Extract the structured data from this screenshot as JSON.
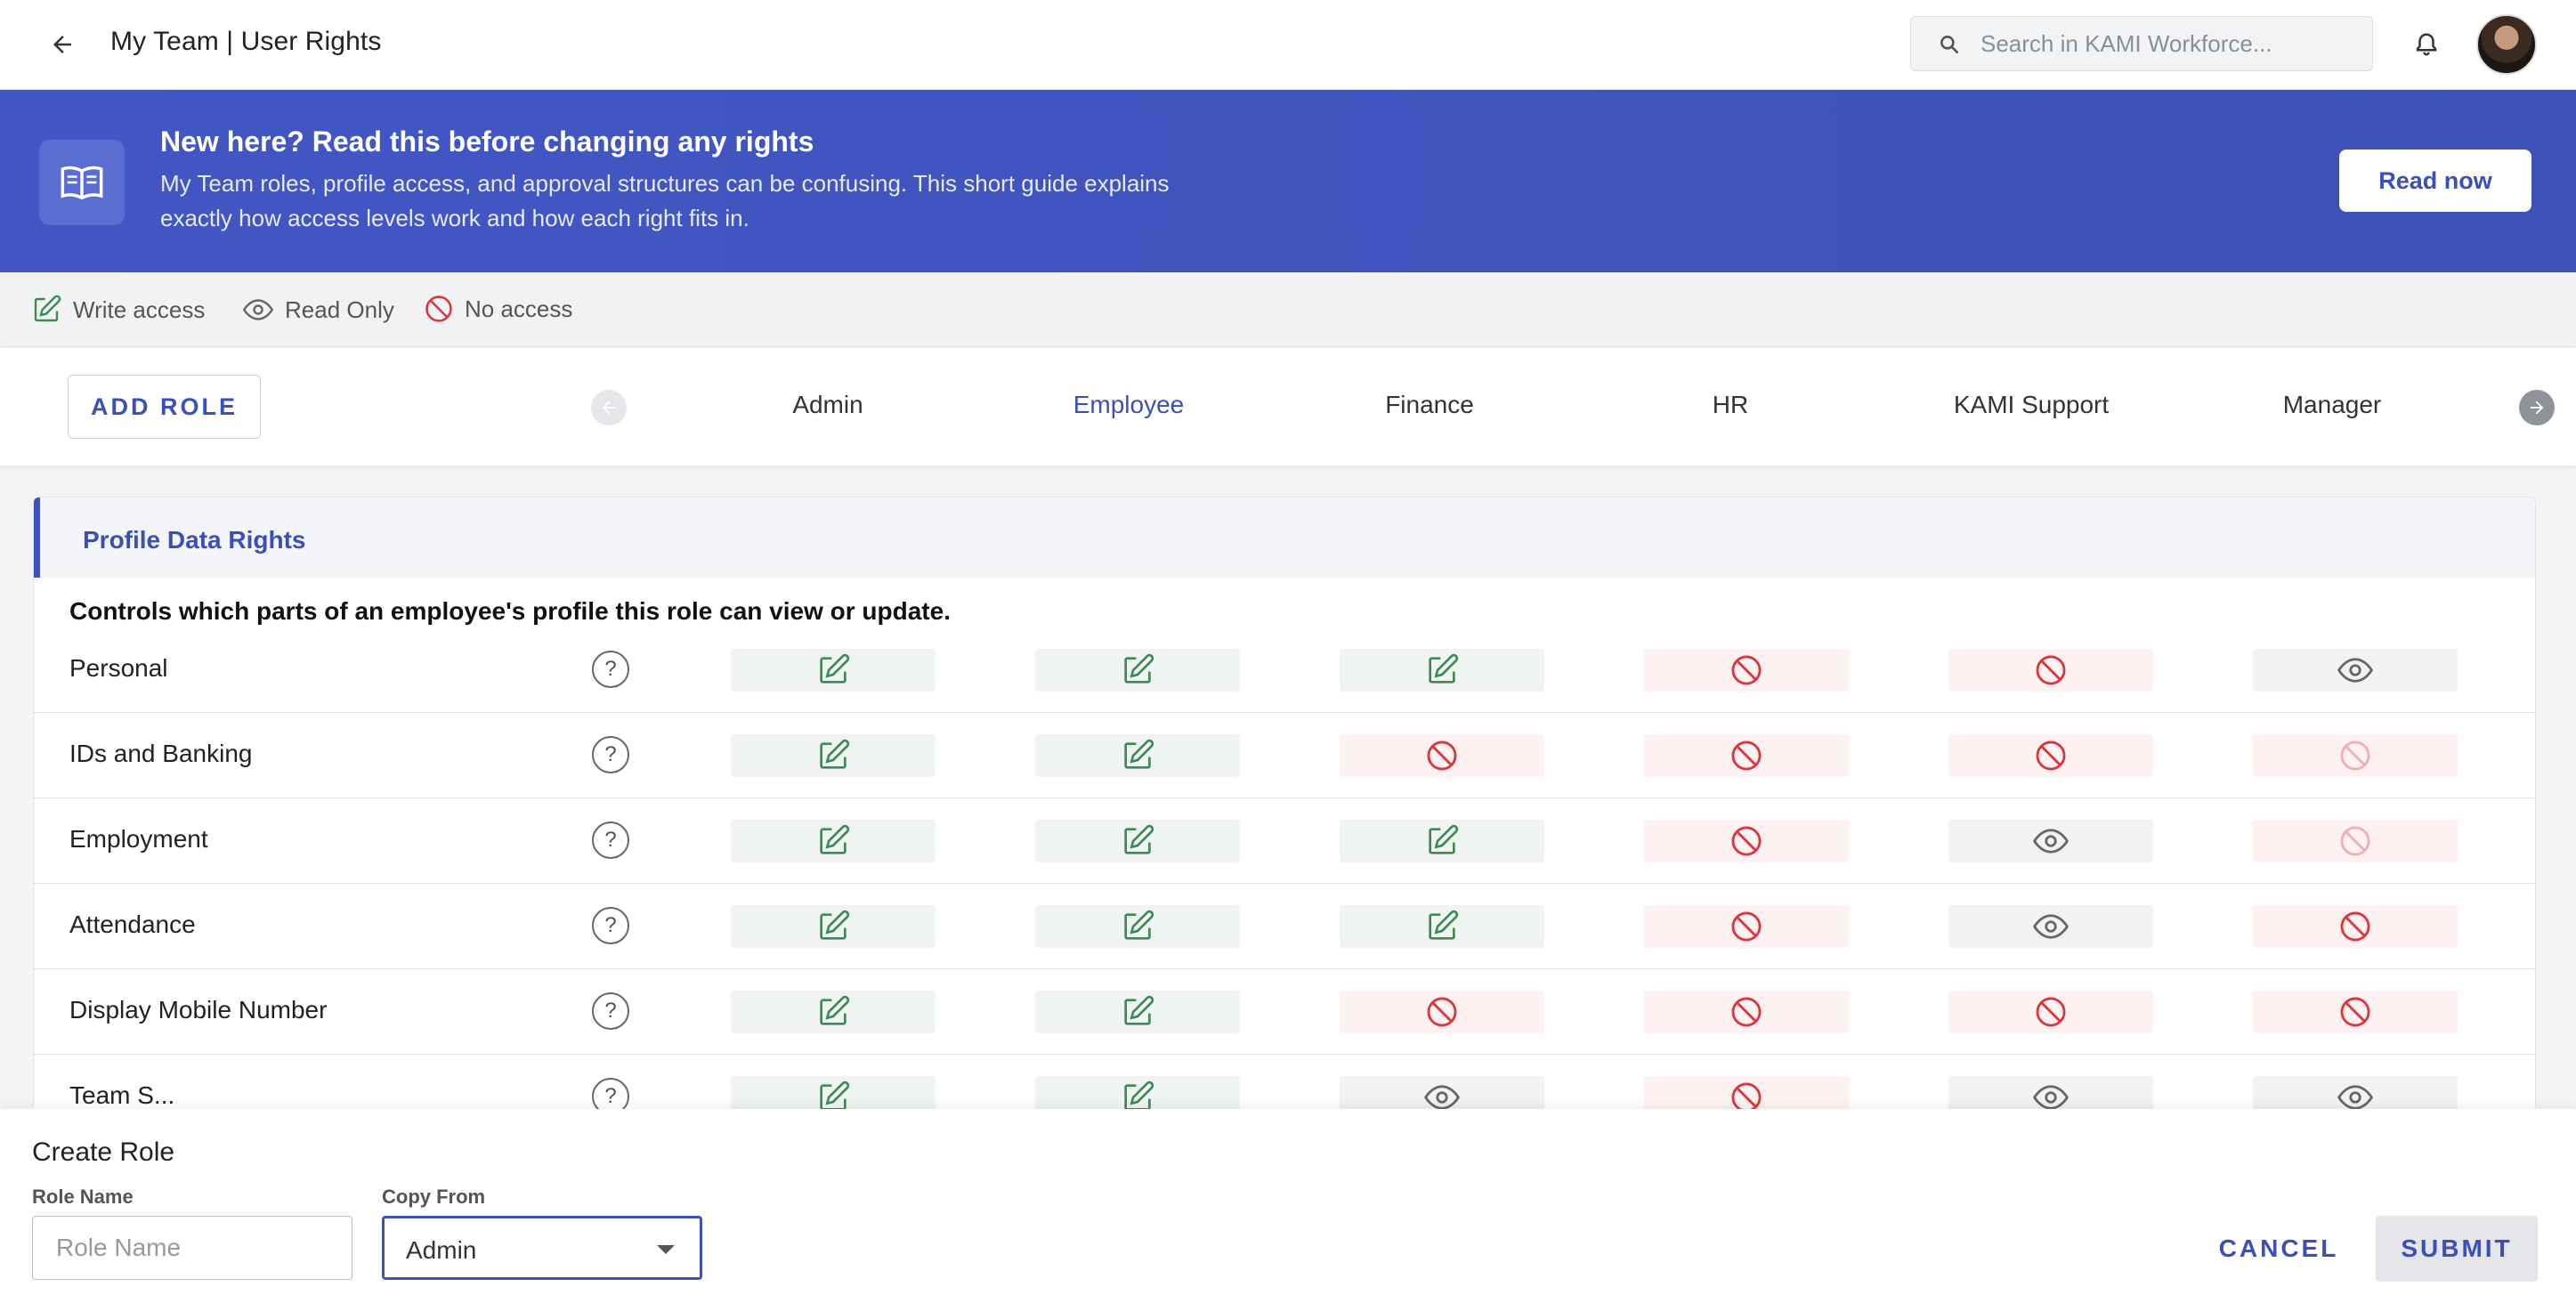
{
  "header": {
    "title": "My Team | User Rights",
    "search_placeholder": "Search in KAMI Workforce..."
  },
  "banner": {
    "title": "New here? Read this before changing any rights",
    "text": "My Team roles, profile access, and approval structures can be confusing. This short guide explains exactly how access levels work and how each right fits in.",
    "button": "Read now"
  },
  "legend": {
    "write": "Write access",
    "read": "Read Only",
    "none": "No access"
  },
  "rolebar": {
    "add_role": "ADD ROLE",
    "roles": [
      "Admin",
      "Employee",
      "Finance",
      "HR",
      "KAMI Support",
      "Manager"
    ],
    "active_role": "Employee"
  },
  "section": {
    "title": "Profile Data Rights",
    "description": "Controls which parts of an employee's profile this role can view or update.",
    "rows": [
      {
        "label": "Personal",
        "rights": [
          "write",
          "write",
          "write",
          "none",
          "none",
          "read"
        ]
      },
      {
        "label": "IDs and Banking",
        "rights": [
          "write",
          "write",
          "none",
          "none",
          "none",
          "none-faded"
        ]
      },
      {
        "label": "Employment",
        "rights": [
          "write",
          "write",
          "write",
          "none",
          "read",
          "none-faded"
        ]
      },
      {
        "label": "Attendance",
        "rights": [
          "write",
          "write",
          "write",
          "none",
          "read",
          "none"
        ]
      },
      {
        "label": "Display Mobile Number",
        "rights": [
          "write",
          "write",
          "none",
          "none",
          "none",
          "none"
        ]
      },
      {
        "label": "Team S...",
        "rights": [
          "write",
          "write",
          "read",
          "none",
          "read",
          "read"
        ]
      }
    ]
  },
  "create_role": {
    "title": "Create Role",
    "role_name_label": "Role Name",
    "role_name_placeholder": "Role Name",
    "copy_from_label": "Copy From",
    "copy_from_value": "Admin",
    "cancel": "CANCEL",
    "submit": "SUBMIT"
  },
  "colors": {
    "accent": "#3d51b8",
    "write": "#3e8a55",
    "none": "#d9363e",
    "read": "#666666"
  }
}
